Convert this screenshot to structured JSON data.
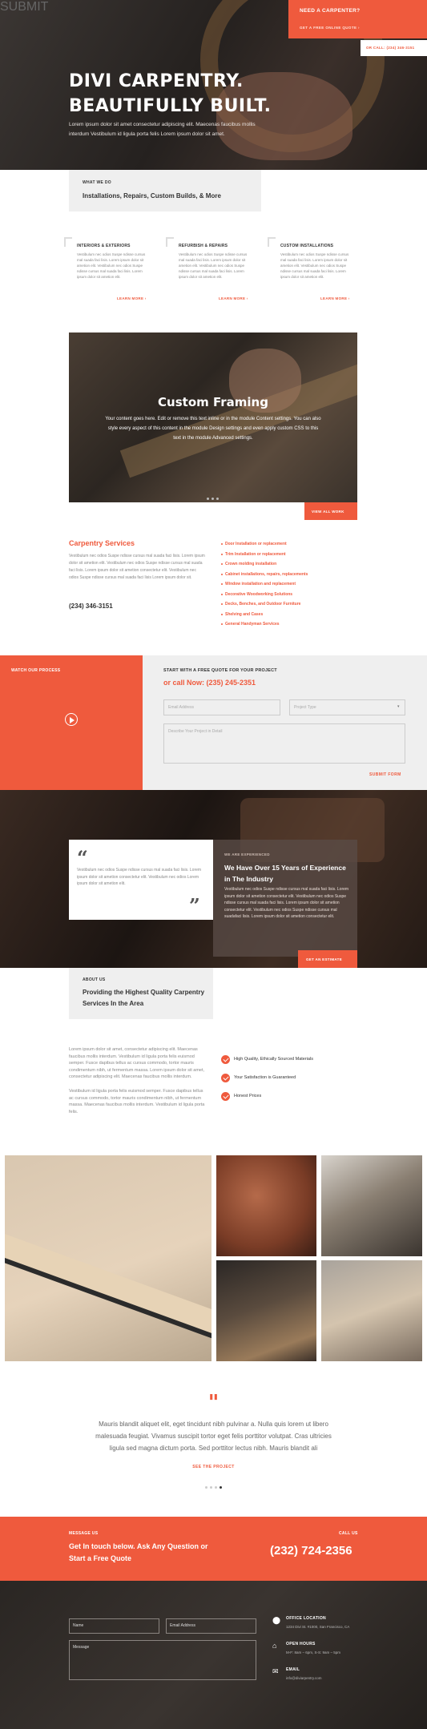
{
  "hero": {
    "title_line1": "DIVI CARPENTRY.",
    "title_line2": "BEAUTIFULLY BUILT.",
    "text": "Lorem ipsum dolor sit amet consectetur adipiscing elit. Maecenas faucibus mollis interdum Vestibulum id ligula porta felis Lorem ipsum dolor sit amet."
  },
  "cta": {
    "title": "NEED A CARPENTER?",
    "link": "GET A FREE ONLINE QUOTE ›",
    "call": "OR CALL: (234) 346-3151"
  },
  "what_we_do": {
    "kicker": "WHAT WE DO",
    "heading": "Installations, Repairs, Custom Builds, & More"
  },
  "services": [
    {
      "title": "INTERIORS & EXTERIORS",
      "text": "Vestibulum nec odios Suspe ndisse cursus mal suada faci lisis. Lorem ipsum dolor sit ametion elit. Vestibulum nec odios Suspe ndisse cursus mal suada faci lisis. Lorem ipsum dolor sit ametion elit.",
      "link": "LEARN MORE ›"
    },
    {
      "title": "REFURBISH & REPAIRS",
      "text": "Vestibulum nec odios Suspe ndisse cursus mal suada faci lisis. Lorem ipsum dolor sit ametion elit. Vestibulum nec odios Suspe ndisse cursus mal suada faci lisis. Lorem ipsum dolor sit ametion elit.",
      "link": "LEARN MORE ›"
    },
    {
      "title": "CUSTOM INSTALLATIONS",
      "text": "Vestibulum nec odios Suspe ndisse cursus mal suada faci lisis. Lorem ipsum dolor sit ametion elit. Vestibulum nec odios Suspe ndisse cursus mal suada faci lisis. Lorem ipsum dolor sit ametion elit.",
      "link": "LEARN MORE ›"
    }
  ],
  "slider": {
    "title": "Custom Framing",
    "text": "Your content goes here. Edit or remove this text inline or in the module Content settings. You can also style every aspect of this content in the module Design settings and even apply custom CSS to this text in the module Advanced settings.",
    "button": "VIEW ALL WORK"
  },
  "carpentry": {
    "title": "Carpentry Services",
    "text": "Vestibulum nec odios Suspe ndisse cursus mal suada faci lisis. Lorem ipsum dolor sit ametion elit. Vestibulum nec odios Suspe ndisse cursus mal suada faci lisis. Lorem ipsum dolor sit ametion consectetur elit. Vestibulum nec odios Suspe ndisse cursus mal suada faci lisis Lorem ipsum dolor sit.",
    "phone": "(234) 346-3151",
    "list": [
      "Door Installation or replacement",
      "Trim Installation or replacement",
      "Crown molding installation",
      "Cabinet installations, repairs, replacements",
      "Window installation and replacement",
      "Decorative Woodworking Solutions",
      "Decks, Benches, and Outdoor Furniture",
      "Shelving and Cases",
      "General Handyman Services"
    ]
  },
  "process": {
    "title": "WATCH OUR PROCESS"
  },
  "quote_form": {
    "kicker": "START WITH A FREE QUOTE FOR YOUR PROJECT",
    "phone": "or call Now: (235) 245-2351",
    "email_placeholder": "Email Address",
    "type_placeholder": "Project Type",
    "detail_placeholder": "Describe Your Project in Detail",
    "submit": "SUBMIT FORM"
  },
  "experience": {
    "quote_text": "Vestibulum nec odios Suspe ndisse cursus mal suada faci lisis. Lorem ipsum dolor sit ametion consectetur elit. Vestibulum nec odios Lorem ipsum dolor sit ametion elit.",
    "kicker": "WE ARE EXPERIENCED",
    "heading": "We Have Over 15 Years of Experience in The Industry",
    "text": "Vestibulum nec odios Suspe ndisse cursus mal suada faci lisis. Lorem ipsum dolor sit ametion consectetur elit. Vestibulum nec odios Suspe ndisse cursus mal suada faci lisis. Lorem ipsum dolor sit ametion consectetur elit. Vestibulum nec odios Suspe ndisse cursus mal suadafaci lisis. Lorem ipsum dolor sit ametion consectetur elit.",
    "button": "GET AN ESTIMATE"
  },
  "about": {
    "kicker": "ABOUT US",
    "heading": "Providing the Highest Quality Carpentry Services In the Area",
    "p1": "Lorem ipsum dolor sit amet, consectetur adipiscing elit. Maecenas faucibus mollis interdum. Vestibulum id ligula porta felis euismod semper. Fusce dapibus tellus ac cursus commodo, tortor mauris condimentum nibh, ut fermentum massa. Lorem ipsum dolor sit amet, consectetur adipiscing elit. Maecenas faucibus mollis interdum.",
    "p2": "Vestibulum id ligula porta felis euismod semper. Fusce dapibus tellus ac cursus commodo, tortor mauris condimentum nibh, ut fermentum massa. Maecenas faucibus mollis interdum. Vestibulum id ligula porta felis.",
    "checks": [
      "High Quality, Ethically Sourced Materials",
      "Your Satisfaction is Guaranteed",
      "Honest Prices"
    ]
  },
  "testimonial": {
    "mark": "\"",
    "text": "Mauris blandit aliquet elit, eget tincidunt nibh pulvinar a. Nulla quis lorem ut libero malesuada feugiat. Vivamus suscipit tortor eget felis porttitor volutpat. Cras ultricies ligula sed magna dictum porta. Sed porttitor lectus nibh. Mauris blandit ali",
    "link": "SEE THE PROJECT"
  },
  "message": {
    "kicker": "MESSAGE US",
    "heading": "Get In touch below. Ask Any Question or Start a Free Quote",
    "call_kicker": "CALL US",
    "phone": "(232) 724-2356"
  },
  "footer": {
    "name_placeholder": "Name",
    "email_placeholder": "Email Address",
    "message_placeholder": "Message",
    "submit": "SUBMIT",
    "location_title": "OFFICE LOCATION",
    "location": "1234 Divi St. #1000, San Francisco, CA",
    "hours_title": "OPEN HOURS",
    "hours": "M-F: 8am – 6pm, S-S: 9am – 5pm",
    "email_title": "EMAIL",
    "email": "info@diviarpentry.com"
  },
  "colors": {
    "accent": "#ef5a3d",
    "light_bg": "#efefef",
    "dark_text": "#333333"
  }
}
